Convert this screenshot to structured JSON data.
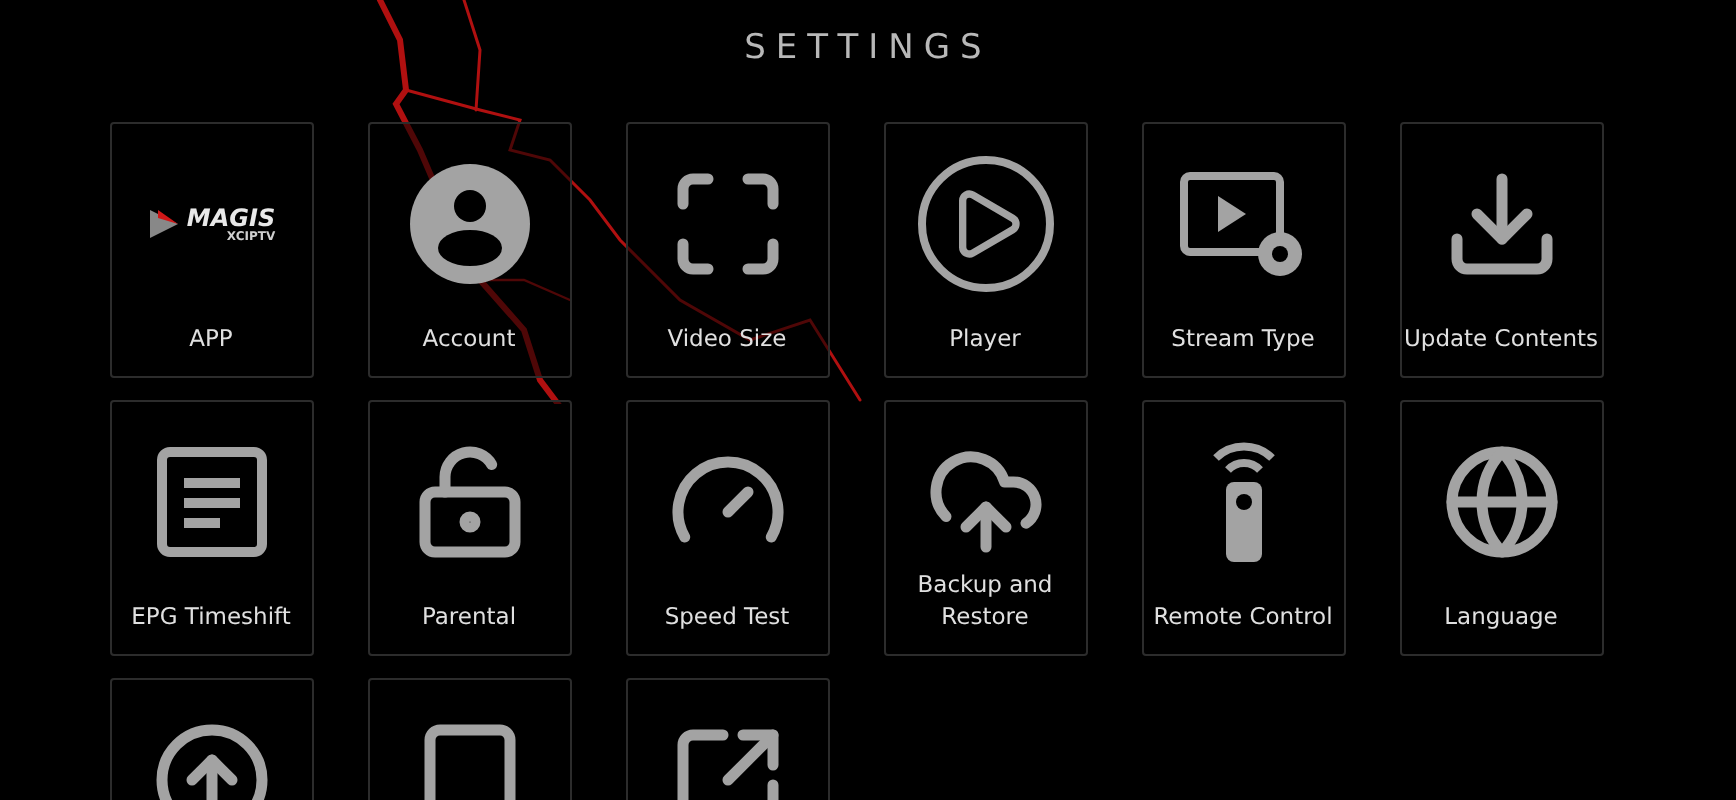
{
  "title": "SETTINGS",
  "tiles": [
    {
      "kind": "logo",
      "logo": {
        "word": "MAGIS",
        "sub": "XCIPTV"
      },
      "label": "APP"
    },
    {
      "kind": "account",
      "label": "Account"
    },
    {
      "kind": "video-size",
      "label": "Video Size"
    },
    {
      "kind": "player",
      "label": "Player"
    },
    {
      "kind": "stream-type",
      "label": "Stream Type"
    },
    {
      "kind": "update",
      "label": "Update Contents"
    },
    {
      "kind": "epg",
      "label": "EPG Timeshift"
    },
    {
      "kind": "parental",
      "label": "Parental"
    },
    {
      "kind": "speed",
      "label": "Speed Test"
    },
    {
      "kind": "backup",
      "label": "Backup and Restore"
    },
    {
      "kind": "remote",
      "label": "Remote Control"
    },
    {
      "kind": "language",
      "label": "Language"
    },
    {
      "kind": "compass"
    },
    {
      "kind": "device-add"
    },
    {
      "kind": "external"
    }
  ]
}
